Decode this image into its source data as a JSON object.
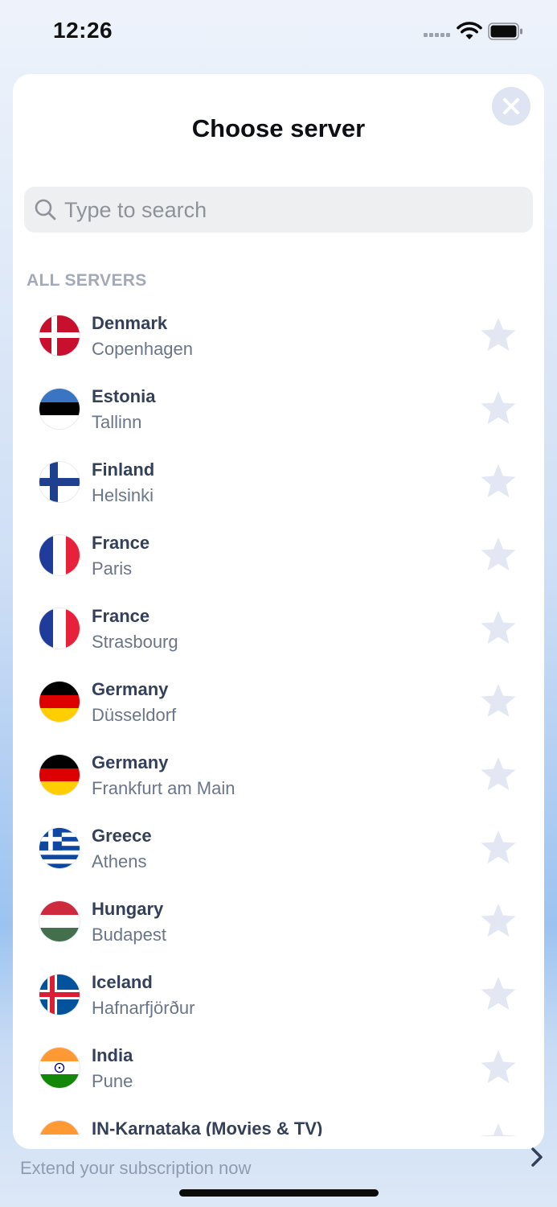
{
  "status_bar": {
    "time": "12:26"
  },
  "modal": {
    "title": "Choose server",
    "close_icon": "close-icon",
    "search": {
      "placeholder": "Type to search",
      "value": ""
    },
    "section_header": "ALL SERVERS",
    "servers": [
      {
        "country": "Denmark",
        "city": "Copenhagen",
        "flag": "denmark"
      },
      {
        "country": "Estonia",
        "city": "Tallinn",
        "flag": "estonia"
      },
      {
        "country": "Finland",
        "city": "Helsinki",
        "flag": "finland"
      },
      {
        "country": "France",
        "city": "Paris",
        "flag": "france"
      },
      {
        "country": "France",
        "city": "Strasbourg",
        "flag": "france"
      },
      {
        "country": "Germany",
        "city": "Düsseldorf",
        "flag": "germany"
      },
      {
        "country": "Germany",
        "city": "Frankfurt am Main",
        "flag": "germany"
      },
      {
        "country": "Greece",
        "city": "Athens",
        "flag": "greece"
      },
      {
        "country": "Hungary",
        "city": "Budapest",
        "flag": "hungary"
      },
      {
        "country": "Iceland",
        "city": "Hafnarfjörður",
        "flag": "iceland"
      },
      {
        "country": "India",
        "city": "Pune",
        "flag": "india"
      },
      {
        "country": "IN-Karnataka (Movies & TV)",
        "city": "",
        "flag": "india"
      }
    ],
    "favorite_icon": "star-icon"
  },
  "background_banner": {
    "subtitle": "Extend your subscription now",
    "chevron_icon": "chevron-right-icon"
  },
  "colors": {
    "sheet_bg": "#ffffff",
    "country_text": "#34405a",
    "city_text": "#6b7589",
    "section_header": "#a3a9b7",
    "star": "#e3e7f3",
    "close_button_bg": "#dfe4f2"
  }
}
